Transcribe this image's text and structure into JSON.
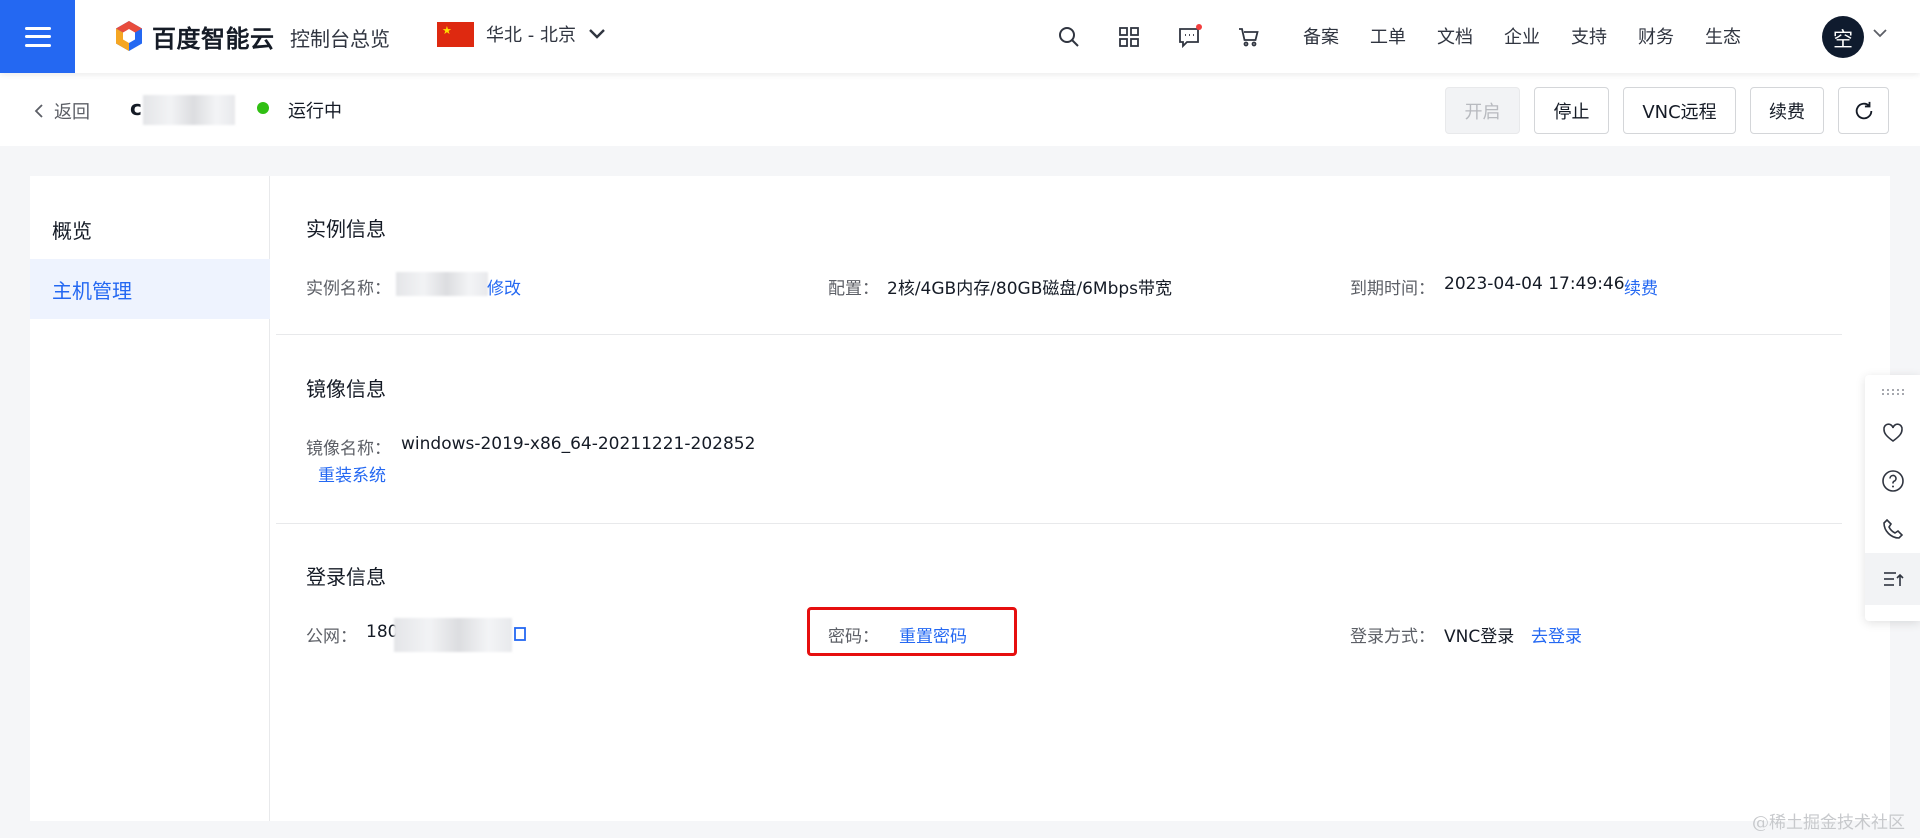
{
  "topbar": {
    "logo_text": "百度智能云",
    "console_label": "控制台总览",
    "region_label": "华北 - 北京",
    "nav_links": [
      "备案",
      "工单",
      "文档",
      "企业",
      "支持",
      "财务",
      "生态"
    ],
    "avatar_text": "空"
  },
  "subheader": {
    "back_label": "返回",
    "instance_name_visible": "c",
    "status_text": "运行中",
    "status_color": "#30bf13",
    "buttons": [
      "开启",
      "停止",
      "VNC远程",
      "续费"
    ]
  },
  "sidebar": {
    "items": [
      "概览",
      "主机管理"
    ],
    "active": "主机管理"
  },
  "instance_info": {
    "title": "实例信息",
    "name_label": "实例名称：",
    "modify_link": "修改",
    "config_label": "配置：",
    "config_value": "2核/4GB内存/80GB磁盘/6Mbps带宽",
    "expire_label": "到期时间：",
    "expire_value": "2023-04-04 17:49:46",
    "renew_link": "续费"
  },
  "image_info": {
    "title": "镜像信息",
    "name_label": "镜像名称：",
    "name_value": "windows-2019-x86_64-20211221-202852",
    "reinstall_link": "重装系统"
  },
  "login_info": {
    "title": "登录信息",
    "public_ip_label": "公网：",
    "public_ip_visible": "180",
    "password_label": "密码：",
    "reset_password_link": "重置密码",
    "login_method_label": "登录方式：",
    "login_method_value": "VNC登录",
    "go_login_link": "去登录"
  },
  "watermark": "@稀土掘金技术社区",
  "colors": {
    "accent": "#2468f2",
    "highlight": "#e60f0f"
  }
}
